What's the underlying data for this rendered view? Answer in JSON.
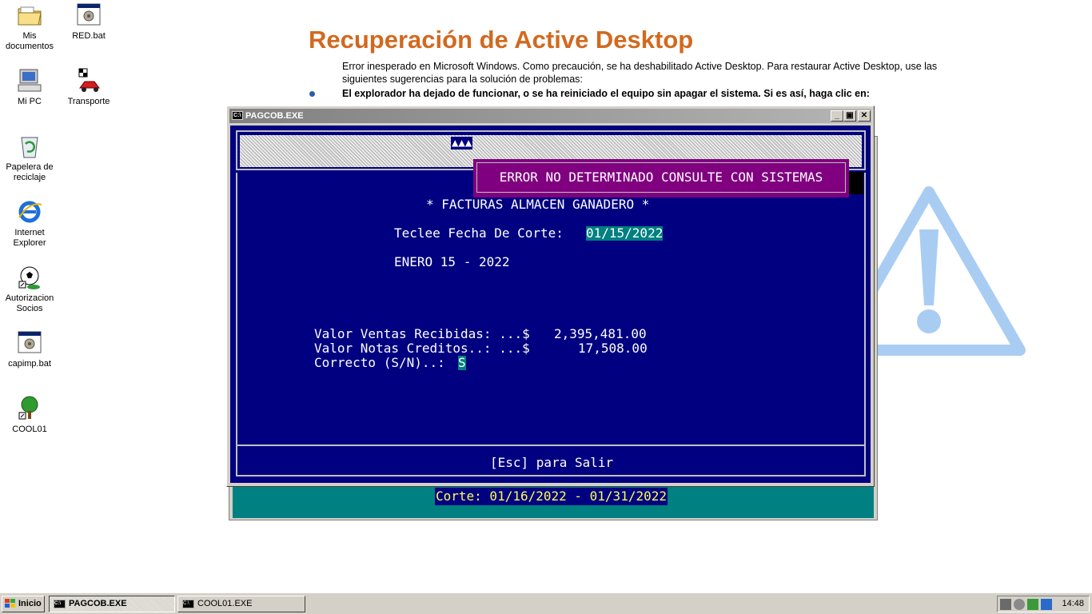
{
  "desktop": {
    "icons": [
      {
        "label": "Mis documentos",
        "icon": "folder-icon"
      },
      {
        "label": "RED.bat",
        "icon": "batch-file-icon"
      },
      {
        "label": "Mi PC",
        "icon": "computer-icon"
      },
      {
        "label": "Transporte",
        "icon": "race-car-icon"
      },
      {
        "label": "Papelera de reciclaje",
        "icon": "recycle-bin-icon"
      },
      {
        "label": "Internet Explorer",
        "icon": "ie-icon"
      },
      {
        "label": "Autorizacion Socios",
        "icon": "soccer-ball-icon"
      },
      {
        "label": "capimp.bat",
        "icon": "batch-file-icon"
      },
      {
        "label": "COOL01",
        "icon": "tree-icon"
      }
    ]
  },
  "active_desktop": {
    "title": "Recuperación de Active Desktop",
    "message": "Error inesperado en Microsoft Windows. Como precaución, se ha deshabilitado Active Desktop. Para restaurar Active Desktop, use las siguientes sugerencias para la solución de problemas:",
    "bullet": "El explorador ha dejado de funcionar, o se ha reiniciado el equipo sin apagar el sistema. Si es así, haga clic en:"
  },
  "background_window": {
    "corte": "Corte: 01/16/2022 - 01/31/2022"
  },
  "window": {
    "title": "PAGCOB.EXE",
    "buttons": {
      "minimize": "_",
      "maximize": "▣",
      "close": "✕"
    }
  },
  "console": {
    "arrows": "▲▲▲",
    "error": "ERROR NO DETERMINADO CONSULTE CON SISTEMAS",
    "heading": "* FACTURAS ALMACEN GANADERO *",
    "fecha_label": "Teclee Fecha De Corte:",
    "fecha_value": "01/15/2022",
    "fecha_texto": "ENERO 15 - 2022",
    "ventas_label": "Valor Ventas Recibidas: ...$",
    "ventas_value": "2,395,481.00",
    "notas_label": "Valor Notas Creditos..: ...$",
    "notas_value": "17,508.00",
    "correcto_label": "Correcto (S/N)..:",
    "correcto_value": "S",
    "footer": "[Esc] para Salir"
  },
  "taskbar": {
    "start": "Inicio",
    "tasks": [
      {
        "label": "PAGCOB.EXE",
        "active": true
      },
      {
        "label": "COOL01.EXE",
        "active": false
      }
    ],
    "clock": "14:48"
  },
  "colors": {
    "console_bg": "#000080",
    "error_bg": "#800080",
    "highlight": "#008080",
    "title_orange": "#d2691e"
  }
}
